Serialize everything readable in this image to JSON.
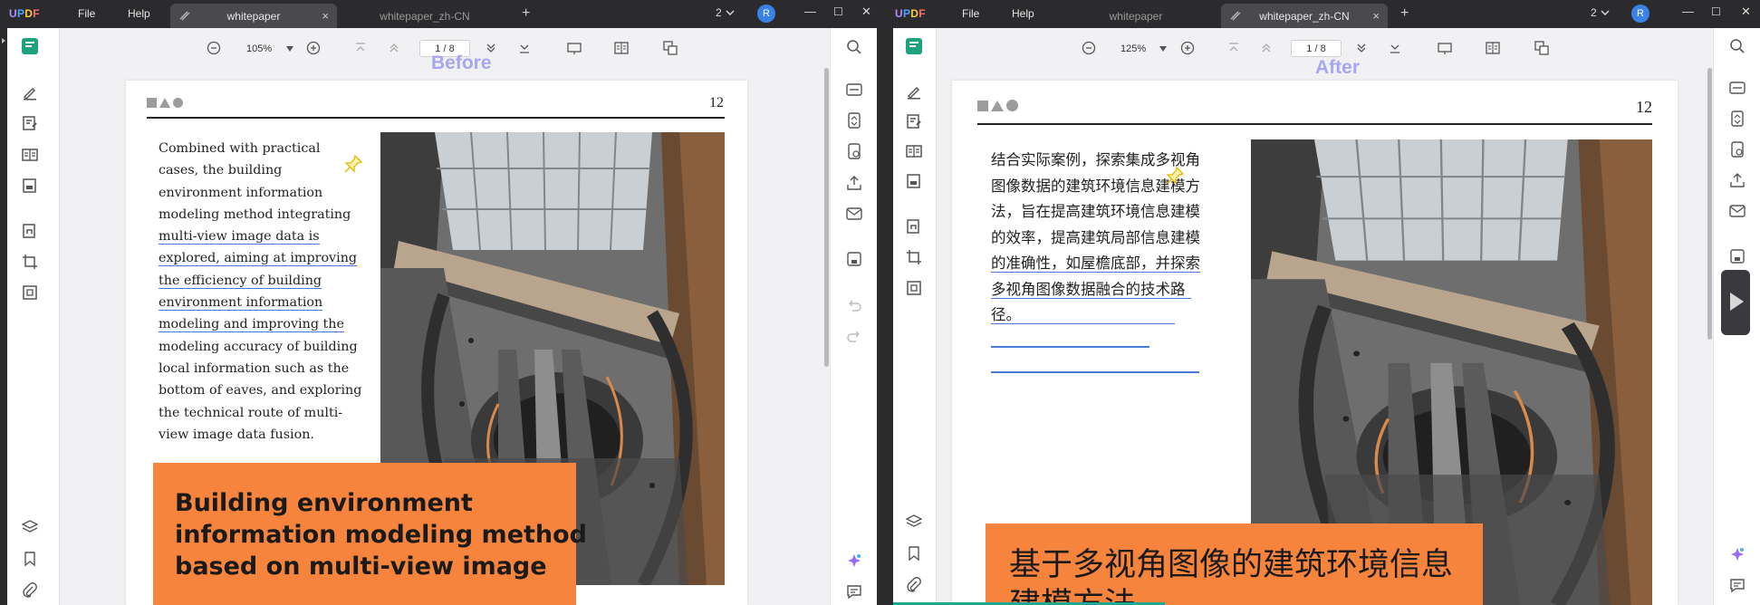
{
  "app": {
    "logo": "UPDF",
    "menu_file": "File",
    "menu_help": "Help"
  },
  "colors": {
    "accent": "#4a78d8",
    "orange_block": "#f7843d",
    "caption": "#a9a6f0",
    "avatar": "#3b82e6",
    "titlebar": "#2b2b2e"
  },
  "left": {
    "tabs": [
      {
        "label": "whitepaper",
        "active": true
      },
      {
        "label": "whitepaper_zh-CN",
        "active": false
      }
    ],
    "tab_count": "2",
    "avatar_initial": "R",
    "zoom": "105%",
    "page_current": "1",
    "page_sep": "/",
    "page_total": "8",
    "caption": "Before",
    "page_number": "12",
    "body_lines": [
      "Combined with practical",
      "cases, the building",
      "environment information",
      "modeling method integrating",
      "multi-view image data is",
      "explored, aiming at improving",
      "the efficiency of building",
      "environment information",
      "modeling and improving the",
      "modeling accuracy of building",
      "local information such as the",
      "bottom of eaves, and exploring",
      "the technical route of multi-",
      "view image data fusion."
    ],
    "heading_lines": [
      "Building environment",
      "information modeling method",
      "based on multi-view image"
    ]
  },
  "right": {
    "tabs": [
      {
        "label": "whitepaper",
        "active": false
      },
      {
        "label": "whitepaper_zh-CN",
        "active": true
      }
    ],
    "tab_count": "2",
    "avatar_initial": "R",
    "zoom": "125%",
    "page_current": "1",
    "page_sep": "/",
    "page_total": "8",
    "caption": "After",
    "page_number": "12",
    "body_lines": [
      "结合实际案例，探索集成多视角",
      "图像数据的建筑环境信息建模方",
      "法，旨在提高建筑环境信息建模",
      "的效率，提高建筑局部信息建模",
      "的准确性，如屋檐底部，并探索",
      "多视角图像数据融合的技术路",
      "径。"
    ],
    "heading_lines": [
      "基于多视角图像的建筑环境信息",
      "建模方法"
    ]
  },
  "icons": {
    "toolbar": [
      "zoom-out-icon",
      "zoom-in-icon",
      "first-page-icon",
      "prev-page-icon",
      "next-page-icon",
      "last-page-icon",
      "presentation-icon",
      "page-display-icon",
      "compare-icon"
    ],
    "left_sidebar": [
      "reader-icon",
      "comment-icon",
      "edit-pdf-icon",
      "organize-pages-icon",
      "fill-sign-icon",
      "protect-icon",
      "crop-icon",
      "layers-icon",
      "bookmark-icon",
      "attachment-icon"
    ],
    "right_sidebar": [
      "search-icon",
      "ocr-icon",
      "convert-icon",
      "protect-icon",
      "share-icon",
      "email-icon",
      "save-icon",
      "undo-icon",
      "redo-icon",
      "ai-assistant-icon",
      "chat-icon"
    ]
  }
}
